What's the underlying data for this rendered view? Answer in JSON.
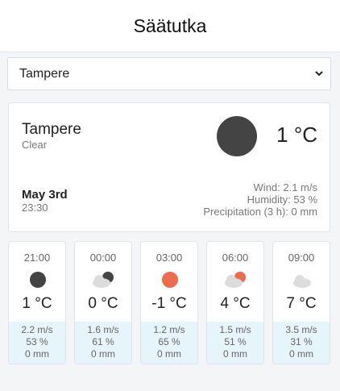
{
  "header": {
    "title": "Säätutka"
  },
  "city_select": {
    "selected": "Tampere"
  },
  "current": {
    "city": "Tampere",
    "description": "Clear",
    "temp": "1 °C",
    "date": "May 3rd",
    "time": "23:30",
    "wind": "Wind: 2.1 m/s",
    "humidity": "Humidity: 53 %",
    "precipitation": "Precipitation (3 h): 0 mm",
    "icon": "clear-night-icon"
  },
  "forecast": [
    {
      "time": "21:00",
      "temp": "1 °C",
      "wind": "2.2 m/s",
      "humidity": "53 %",
      "precip": "0 mm",
      "icon": "clear-night-icon"
    },
    {
      "time": "00:00",
      "temp": "0 °C",
      "wind": "1.6 m/s",
      "humidity": "61 %",
      "precip": "0 mm",
      "icon": "partly-cloudy-night-icon"
    },
    {
      "time": "03:00",
      "temp": "-1 °C",
      "wind": "1.2 m/s",
      "humidity": "65 %",
      "precip": "0 mm",
      "icon": "clear-day-icon"
    },
    {
      "time": "06:00",
      "temp": "4 °C",
      "wind": "1.5 m/s",
      "humidity": "51 %",
      "precip": "0 mm",
      "icon": "partly-cloudy-day-icon"
    },
    {
      "time": "09:00",
      "temp": "7 °C",
      "wind": "3.5 m/s",
      "humidity": "31 %",
      "precip": "0 mm",
      "icon": "cloud-icon"
    }
  ],
  "colors": {
    "night": "#444444",
    "sun": "#ee6b4d",
    "cloud": "#dcdcdc",
    "detail_bg": "#e6f4fb"
  }
}
